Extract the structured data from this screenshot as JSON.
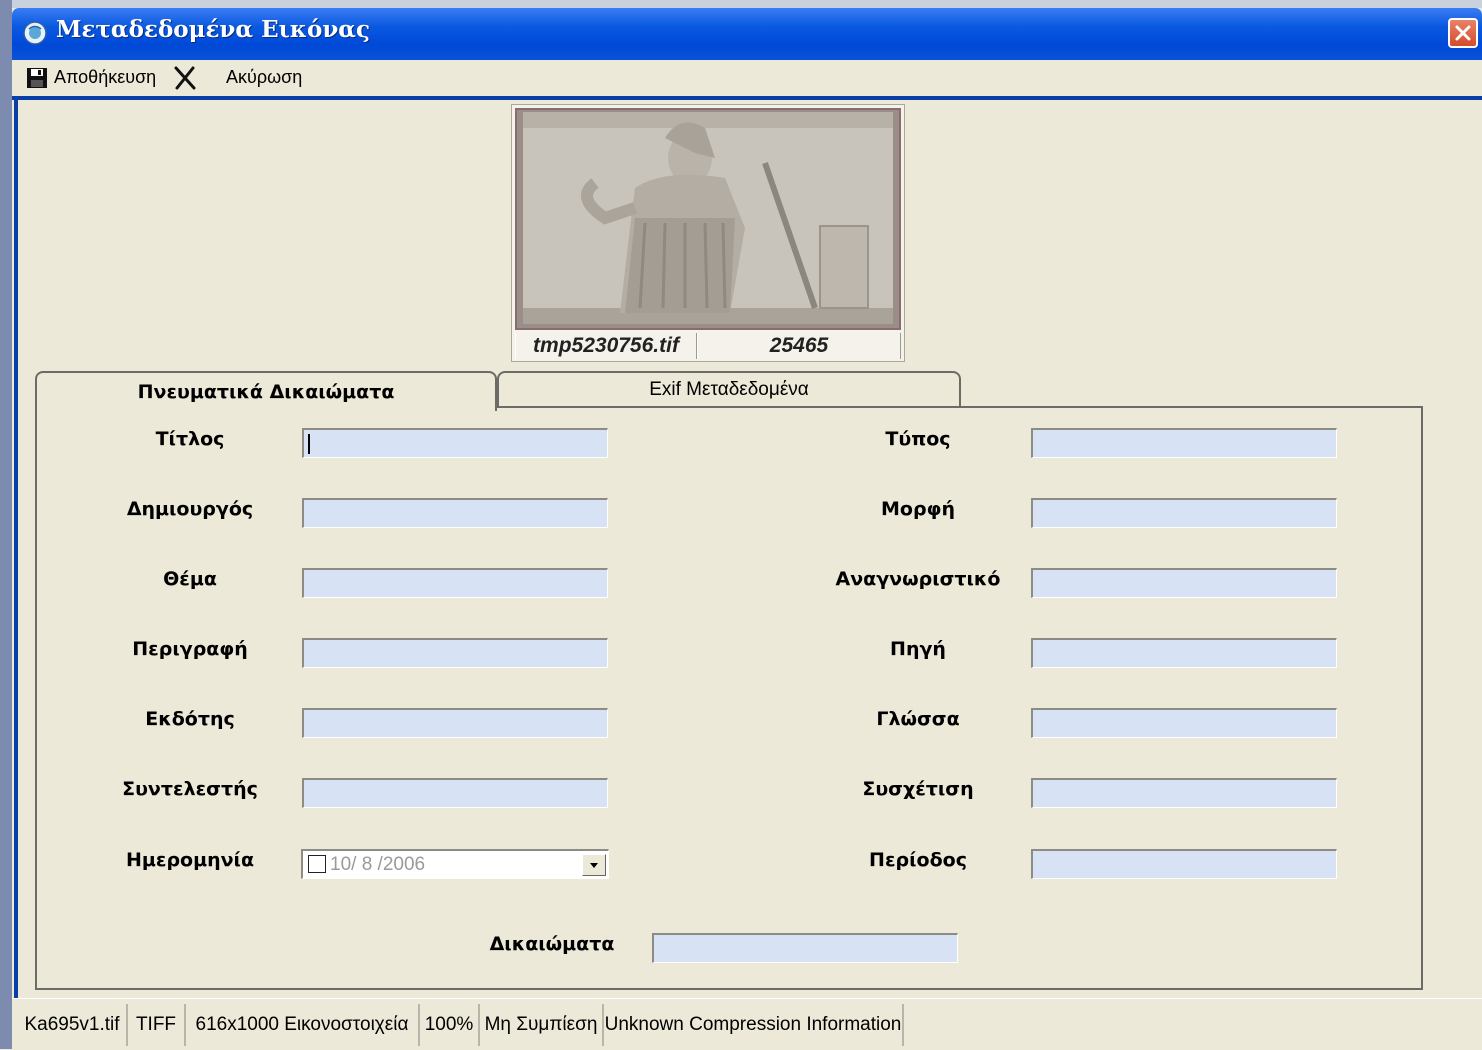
{
  "window": {
    "title": "Μεταδεδομένα Εικόνας"
  },
  "toolbar": {
    "save_label": "Αποθήκευση",
    "cancel_label": "Ακύρωση"
  },
  "preview": {
    "filename": "tmp5230756.tif",
    "id": "25465"
  },
  "tabs": [
    {
      "label": "Πνευματικά Δικαιώματα",
      "active": true
    },
    {
      "label": "Exif Μεταδεδομένα",
      "active": false
    }
  ],
  "form": {
    "title_label": "Τίτλος",
    "title_value": "",
    "creator_label": "Δημιουργός",
    "creator_value": "",
    "subject_label": "Θέμα",
    "subject_value": "",
    "description_label": "Περιγραφή",
    "description_value": "",
    "publisher_label": "Εκδότης",
    "publisher_value": "",
    "contributor_label": "Συντελεστής",
    "contributor_value": "",
    "date_label": "Ημερομηνία",
    "date_value": "10/ 8 /2006",
    "type_label": "Τύπος",
    "type_value": "",
    "format_label": "Μορφή",
    "format_value": "",
    "identifier_label": "Αναγνωριστικό",
    "identifier_value": "",
    "source_label": "Πηγή",
    "source_value": "",
    "language_label": "Γλώσσα",
    "language_value": "",
    "relation_label": "Συσχέτιση",
    "relation_value": "",
    "coverage_label": "Περίοδος",
    "coverage_value": "",
    "rights_label": "Δικαιώματα",
    "rights_value": ""
  },
  "status": {
    "filename": "Ka695v1.tif",
    "format": "TIFF",
    "dimensions": "616x1000 Εικονοστοιχεία",
    "zoom": "100%",
    "compression": "Μη Συμπίεση",
    "compression_info": "Unknown Compression Information"
  },
  "colors": {
    "titlebar": "#0a52d8",
    "field_bg": "#d8e2f5",
    "window_bg": "#ece9d8"
  }
}
